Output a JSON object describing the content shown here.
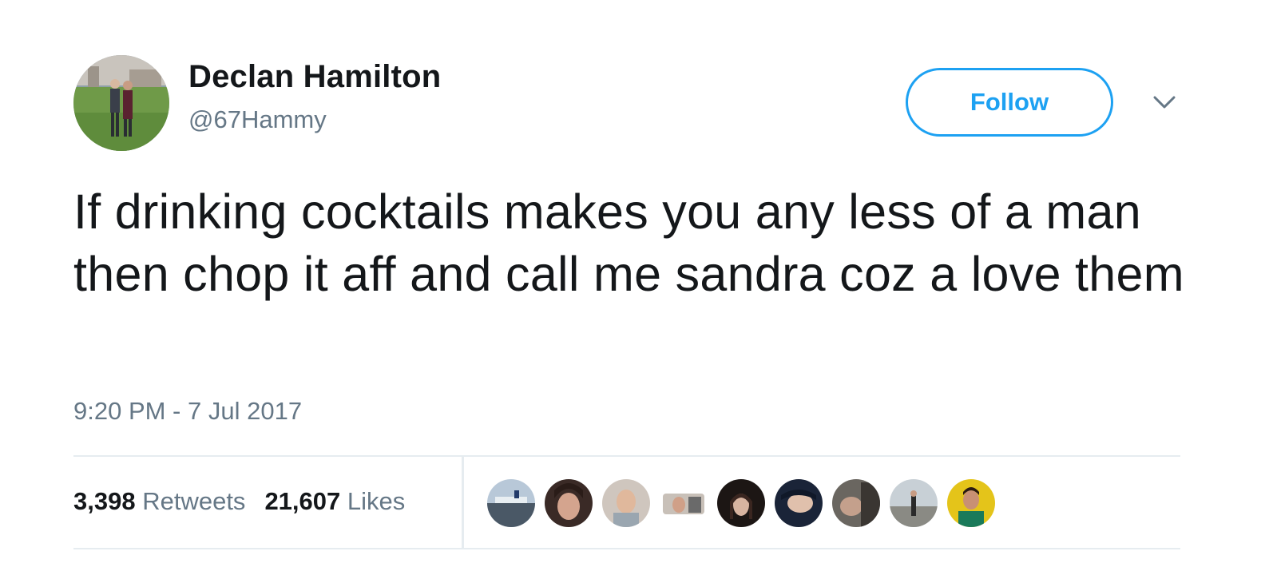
{
  "author": {
    "name": "Declan Hamilton",
    "handle": "@67Hammy"
  },
  "follow_label": "Follow",
  "tweet": {
    "text": "If drinking cocktails makes you any less of a man then chop it aff and call me sandra coz a love them",
    "timestamp": "9:20 PM - 7 Jul 2017"
  },
  "stats": {
    "retweets_count": "3,398",
    "retweets_label": "Retweets",
    "likes_count": "21,607",
    "likes_label": "Likes"
  },
  "liked_by_count": 9,
  "colors": {
    "accent": "#1da1f2",
    "text": "#14171a",
    "secondary": "#657786",
    "divider": "#e6ecf0"
  }
}
